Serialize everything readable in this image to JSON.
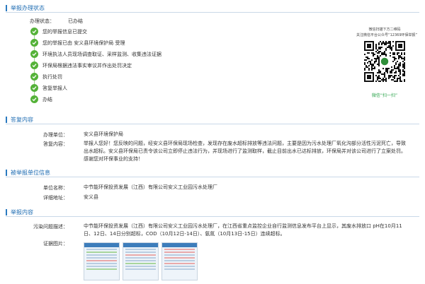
{
  "status_section": {
    "title": "举报办理状态",
    "status_label": "办理状态：",
    "status_value": "已办结",
    "steps": [
      "您的举报信息已提交",
      "您的举报已由 安义县环境保护局 受理",
      "环境执法人员现场调查取证、采样监测、收集违法证据",
      "环保局根据违法事实审议并作出处罚决定",
      "执行处罚",
      "答复举报人",
      "办结"
    ]
  },
  "qr": {
    "caption_1": "微信扫描下方二维码",
    "caption_2": "关注微信平台公众号“12369环保举报”",
    "scan_label": "微信“扫一扫”"
  },
  "reply_section": {
    "title": "答复内容",
    "unit_label": "办理单位：",
    "unit_value": "安义县环境保护局",
    "content_label": "答复内容：",
    "content_value": "举报人您好！您反映的问题，经安义县环保局现场检查，发现存在废水超标排放等违法问题，主要是因为污水处理厂氧化沟部分活性污泥死亡，导致出水超标。安义县环保局已责令该公司立即停止违法行为，并现场进行了监测取样，截止目前出水已达标排放，环保局并对该公司进行了立案处罚。感谢您对环保事业的支持！"
  },
  "reported_section": {
    "title": "被举报单位信息",
    "name_label": "单位名称：",
    "name_value": "中节能环保投资发展（江西）有限公司安义工业园污水处理厂",
    "address_label": "详细地址：",
    "address_value": "安义县"
  },
  "content_section": {
    "title": "举报内容",
    "desc_label": "污染问题描述：",
    "desc_value": "中节能环保投资发展（江西）有限公司安义工业园污水处理厂，在江西省重点监控企业自行监测信息发布平台上显示，其废水排放口 pH在10月11日、12日、14日分别超标，COD（10月12日-14日）、氨氮（10月13日-15日）连续超标。",
    "evidence_label": "证据图片："
  }
}
